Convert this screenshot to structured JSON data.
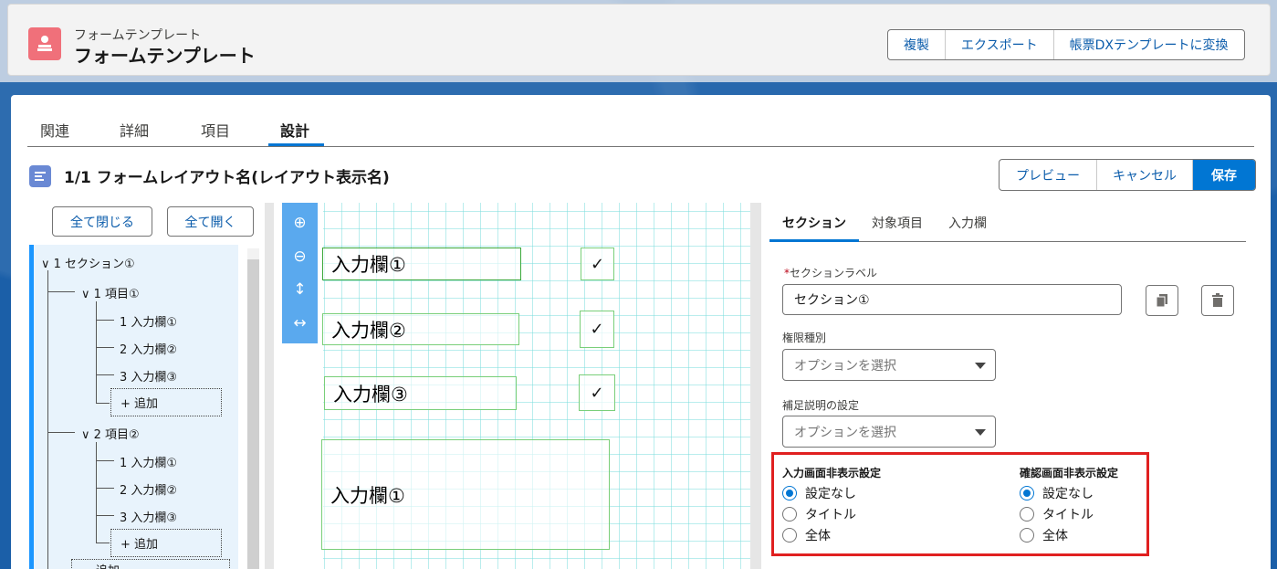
{
  "header": {
    "subtitle": "フォームテンプレート",
    "title": "フォームテンプレート",
    "actions": [
      "複製",
      "エクスポート",
      "帳票DXテンプレートに変換"
    ]
  },
  "tabs": [
    "関連",
    "詳細",
    "項目",
    "設計"
  ],
  "active_tab": "設計",
  "layout": {
    "title": "1/1 フォームレイアウト名(レイアウト表示名)",
    "actions": [
      "プレビュー",
      "キャンセル",
      "保存"
    ]
  },
  "tree": {
    "collapse_all": "全て閉じる",
    "expand_all": "全て開く",
    "section1": "1 セクション①",
    "item1": "1 項目①",
    "item1_fields": [
      "1 入力欄①",
      "2 入力欄②",
      "3 入力欄③"
    ],
    "item2": "2 項目②",
    "item2_fields": [
      "1 入力欄①",
      "2 入力欄②",
      "3 入力欄③"
    ],
    "add": "+ 追加",
    "bottom_add": "追加"
  },
  "canvas": {
    "fields": [
      "入力欄①",
      "入力欄②",
      "入力欄③",
      "入力欄①"
    ],
    "check_mark": "✓"
  },
  "props": {
    "tabs": [
      "セクション",
      "対象項目",
      "入力欄"
    ],
    "section_label_label": "セクションラベル",
    "section_label_value": "セクション①",
    "permission_label": "権限種別",
    "permission_placeholder": "オプションを選択",
    "supplement_label": "補足説明の設定",
    "supplement_placeholder": "オプションを選択",
    "input_hide_label": "入力画面非表示設定",
    "confirm_hide_label": "確認画面非表示設定",
    "radio_options": [
      "設定なし",
      "タイトル",
      "全体"
    ],
    "input_hide_selected": "設定なし",
    "confirm_hide_selected": "設定なし"
  }
}
